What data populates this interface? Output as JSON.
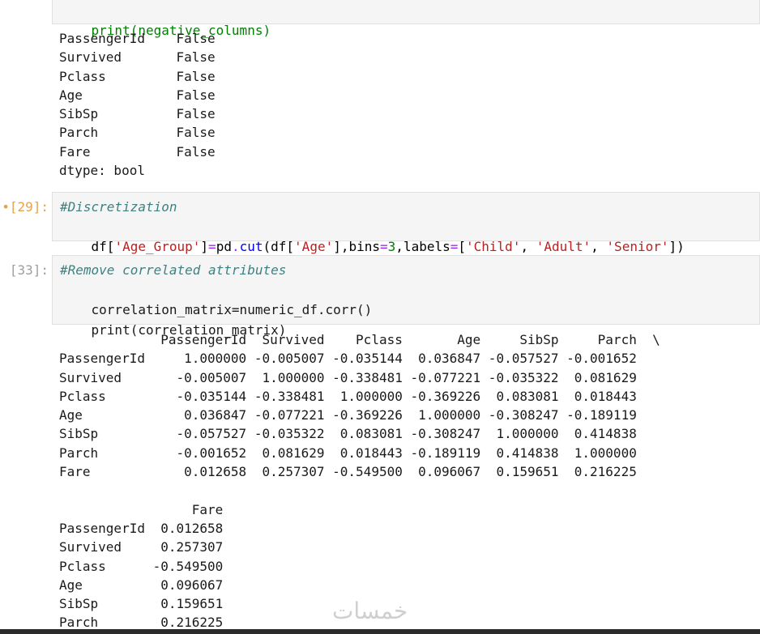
{
  "cell_top": {
    "code_line": "print(negative_columns)"
  },
  "output_negative": {
    "rows": [
      "PassengerId    False",
      "Survived       False",
      "Pclass         False",
      "Age            False",
      "SibSp          False",
      "Parch          False",
      "Fare           False",
      "dtype: bool"
    ]
  },
  "cell_29": {
    "prompt": "[29]:",
    "comment": "#Discretization",
    "code_parts": [
      "df",
      "[",
      "'Age_Group'",
      "]",
      "=",
      "pd",
      ".",
      "cut",
      "(",
      "df",
      "[",
      "'Age'",
      "],",
      "bins",
      "=",
      "3",
      ",",
      "labels",
      "=",
      "[",
      "'Child'",
      ", ",
      "'Adult'",
      ", ",
      "'Senior'",
      "])"
    ]
  },
  "cell_33": {
    "prompt": "[33]:",
    "comment": "#Remove correlated attributes",
    "line2": "correlation_matrix=numeric_df.corr()",
    "line3": "print(correlation_matrix)"
  },
  "corr_output": {
    "header": "             PassengerId  Survived    Pclass       Age     SibSp     Parch  \\",
    "rows": [
      "PassengerId     1.000000 -0.005007 -0.035144  0.036847 -0.057527 -0.001652",
      "Survived       -0.005007  1.000000 -0.338481 -0.077221 -0.035322  0.081629",
      "Pclass         -0.035144 -0.338481  1.000000 -0.369226  0.083081  0.018443",
      "Age             0.036847 -0.077221 -0.369226  1.000000 -0.308247 -0.189119",
      "SibSp          -0.057527 -0.035322  0.083081 -0.308247  1.000000  0.414838",
      "Parch          -0.001652  0.081629  0.018443 -0.189119  0.414838  1.000000",
      "Fare            0.012658  0.257307 -0.549500  0.096067  0.159651  0.216225"
    ],
    "header2": "                 Fare",
    "rows2": [
      "PassengerId  0.012658",
      "Survived     0.257307",
      "Pclass      -0.549500",
      "Age          0.096067",
      "SibSp        0.159651",
      "Parch        0.216225"
    ]
  },
  "watermark": "خمسات"
}
